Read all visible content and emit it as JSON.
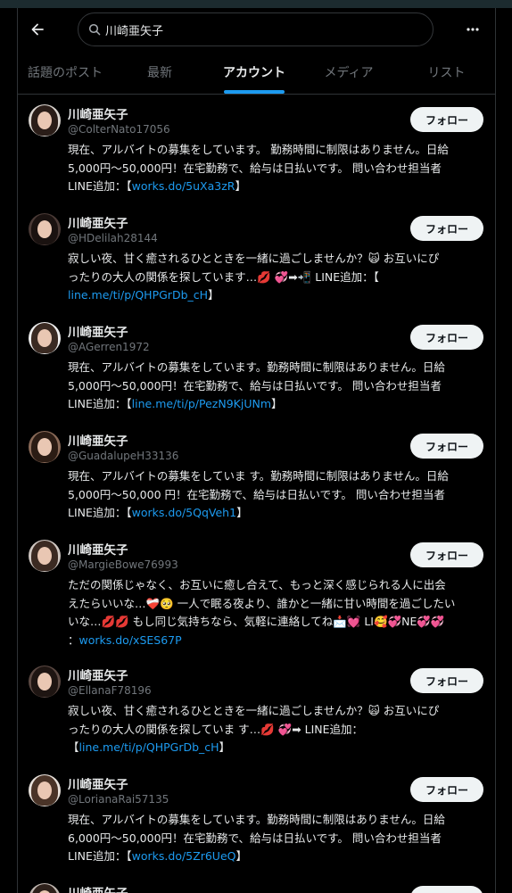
{
  "search": {
    "query": "川崎亜矢子"
  },
  "tabs": [
    {
      "label": "話題のポスト"
    },
    {
      "label": "最新"
    },
    {
      "label": "アカウント"
    },
    {
      "label": "メディア"
    },
    {
      "label": "リスト"
    }
  ],
  "active_tab": "アカウント",
  "follow_label": "フォロー",
  "accounts": [
    {
      "name": "川崎亜矢子",
      "handle": "@ColterNato17056",
      "bio_lines": [
        "現在、アルバイトの募集をしています。 勤務時間に制限はありません。日給",
        "5,000円〜50,000円！在宅勤務で、給与は日払いです。 問い合わせ担当者"
      ],
      "bio_tail_pre": "LINE追加：【",
      "bio_link": "works.do/5uXa3zR",
      "bio_tail_post": "】"
    },
    {
      "name": "川崎亜矢子",
      "handle": "@HDelilah28144",
      "bio_lines": [
        "寂しい夜、甘く癒されるひとときを一緒に過ごしませんか？🙀 お互いにぴ",
        "ったりの大人の関係を探しています…💋 💞➡📲 LINE追加：【"
      ],
      "bio_tail_pre": "",
      "bio_link": "line.me/ti/p/QHPGrDb_cH",
      "bio_tail_post": "】"
    },
    {
      "name": "川崎亜矢子",
      "handle": "@AGerren1972",
      "bio_lines": [
        "現在、アルバイトの募集をしています。勤務時間に制限はありません。日給",
        "5,000円〜50,000円！在宅勤務で、給与は日払いです。 問い合わせ担当者"
      ],
      "bio_tail_pre": "LINE追加：【",
      "bio_link": "line.me/ti/p/PezN9KjUNm",
      "bio_tail_post": "】"
    },
    {
      "name": "川崎亜矢子",
      "handle": "@GuadalupeH33136",
      "bio_lines": [
        "現在、アルバイトの募集をしていま す。勤務時間に制限はありません。日給",
        "5,000円〜50,000 円！在宅勤務で、給与は日払いです。 問い合わせ担当者"
      ],
      "bio_tail_pre": "LINE追加：【",
      "bio_link": "works.do/5QqVeh1",
      "bio_tail_post": "】"
    },
    {
      "name": "川崎亜矢子",
      "handle": "@MargieBowe76993",
      "bio_lines": [
        "ただの関係じゃなく、お互いに癒し合えて、もっと深く感じられる人に出会",
        "えたらいいな…❤️‍🩹🥺 一人で眠る夜より、誰かと一緒に甘い時間を過ごしたい",
        "いな…💋💋 もし同じ気持ちなら、気軽に連絡してね📩💓 LI🥰💞NE💞💞"
      ],
      "bio_tail_pre": "：",
      "bio_link": "works.do/xSES67P",
      "bio_tail_post": ""
    },
    {
      "name": "川崎亜矢子",
      "handle": "@EllanaF78196",
      "bio_lines": [
        "寂しい夜、甘く癒されるひとときを一緒に過ごしませんか？🙀 お互いにぴ",
        "ったりの大人の関係を探していま す…💋 💞➡ LINE追加："
      ],
      "bio_tail_pre": "【",
      "bio_link": "line.me/ti/p/QHPGrDb_cH",
      "bio_tail_post": "】"
    },
    {
      "name": "川崎亜矢子",
      "handle": "@LorianaRai57135",
      "bio_lines": [
        "現在、アルバイトの募集をしています。勤務時間に制限はありません。日給",
        "6,000円〜50,000円！在宅勤務で、給与は日払いです。 問い合わせ担当者"
      ],
      "bio_tail_pre": "LINE追加：【",
      "bio_link": "works.do/5Zr6UeQ",
      "bio_tail_post": "】"
    },
    {
      "name": "川崎亜矢子",
      "handle": "",
      "bio_lines": [],
      "bio_tail_pre": "",
      "bio_link": "",
      "bio_tail_post": ""
    }
  ],
  "colors": {
    "background": "#000000",
    "accent": "#1d9bf0",
    "text": "#e7e9ea",
    "muted": "#71767b",
    "border": "#2f3336"
  },
  "icons": {
    "back": "arrow-left-icon",
    "search": "search-icon",
    "more": "more-horizontal-icon"
  }
}
